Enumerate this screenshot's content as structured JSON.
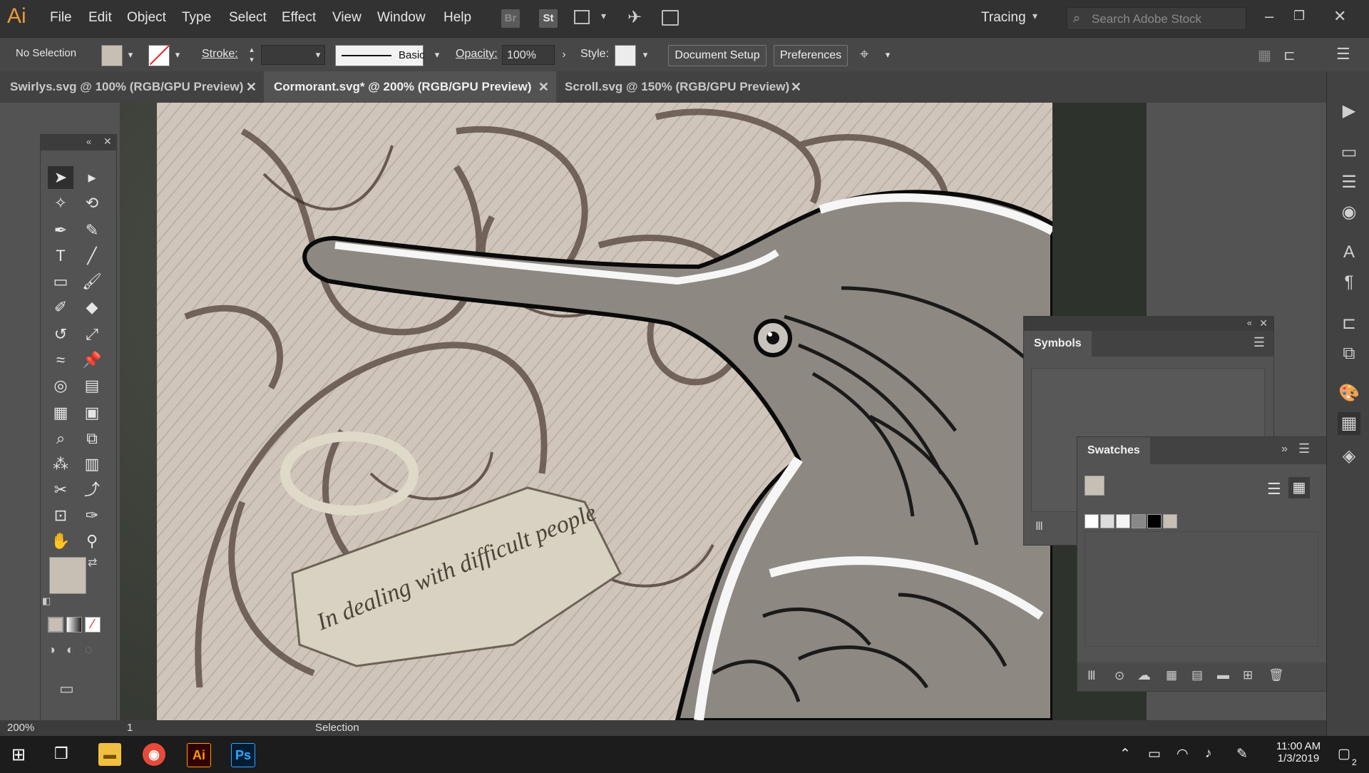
{
  "app": {
    "logo": "Ai",
    "accent": "#e89a3c"
  },
  "menu": [
    "File",
    "Edit",
    "Object",
    "Type",
    "Select",
    "Effect",
    "View",
    "Window",
    "Help"
  ],
  "bridge_icons": {
    "br": "Br",
    "st": "St"
  },
  "workspace": "Tracing",
  "search_placeholder": "Search Adobe Stock",
  "control": {
    "selection": "No Selection",
    "stroke_label": "Stroke:",
    "brush": "Basic",
    "opacity_label": "Opacity:",
    "opacity_value": "100%",
    "style_label": "Style:",
    "document_setup": "Document Setup",
    "preferences": "Preferences"
  },
  "tabs": [
    {
      "label": "Swirlys.svg @ 100% (RGB/GPU Preview)",
      "active": false
    },
    {
      "label": "Cormorant.svg* @ 200% (RGB/GPU Preview)",
      "active": true
    },
    {
      "label": "Scroll.svg @ 150% (RGB/GPU Preview)",
      "active": false
    }
  ],
  "artwork_banner_text": "In dealing with difficult people",
  "panels": {
    "symbols": {
      "title": "Symbols"
    },
    "swatches": {
      "title": "Swatches"
    }
  },
  "status": {
    "zoom": "200%",
    "artboard": "1",
    "tool": "Selection"
  },
  "taskbar": {
    "time": "11:00 AM",
    "date": "1/3/2019",
    "notifications": "2"
  },
  "colors": {
    "fill_swatch": "#c8bfb4",
    "canvas_bg": "#535353",
    "menubar": "#323232"
  }
}
